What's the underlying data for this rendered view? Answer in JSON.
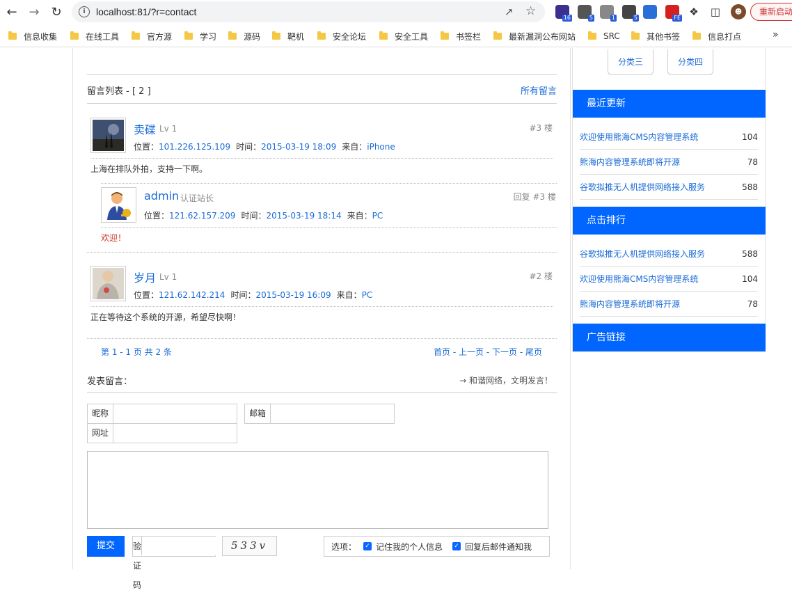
{
  "browser": {
    "url": "localhost:81/?r=contact",
    "restart_label": "重新启动",
    "extensions": [
      {
        "name": "ext-1",
        "badge": "16",
        "color": "#3b2f8f"
      },
      {
        "name": "ext-2",
        "badge": "5",
        "color": "#555555"
      },
      {
        "name": "ext-3",
        "badge": "1",
        "color": "#888888"
      },
      {
        "name": "ext-4",
        "badge": "5",
        "color": "#444444"
      },
      {
        "name": "ext-5",
        "badge": "",
        "color": "#2a6fd6"
      },
      {
        "name": "ext-6",
        "badge": "FE",
        "color": "#d62020"
      }
    ]
  },
  "bookmarks": [
    "信息收集",
    "在线工具",
    "官方源",
    "学习",
    "源码",
    "靶机",
    "安全论坛",
    "安全工具",
    "书签栏",
    "最新漏洞公布网站",
    "SRC",
    "其他书签",
    "信息打点"
  ],
  "comments": {
    "title": "留言列表 - [ 2 ]",
    "all_link": "所有留言",
    "meta_labels": {
      "location": "位置：",
      "time": "时间：",
      "from": "来自："
    },
    "items": [
      {
        "name": "卖碟",
        "level": "Lv 1",
        "floor": "#3 楼",
        "ip": "101.226.125.109",
        "time": "2015-03-19 18:09",
        "from": "iPhone",
        "text": "上海在排队外拍，支持一下啊。",
        "reply": {
          "name": "admin",
          "level": "认证站长",
          "floor": "回复 #3 楼",
          "ip": "121.62.157.209",
          "time": "2015-03-19 18:14",
          "from": "PC",
          "text": "欢迎！"
        }
      },
      {
        "name": "岁月",
        "level": "Lv 1",
        "floor": "#2 楼",
        "ip": "121.62.142.214",
        "time": "2015-03-19 16:09",
        "from": "PC",
        "text": "正在等待这个系统的开源，希望尽快啊！"
      }
    ],
    "pager_info": "第 1 - 1 页 共 2 条",
    "pager": {
      "first": "首页",
      "prev": "上一页",
      "next": "下一页",
      "last": "尾页",
      "sep": " - "
    }
  },
  "form": {
    "title": "发表留言：",
    "hint": "→ 和谐网络，文明发言！",
    "nickname_label": "昵称",
    "email_label": "邮箱",
    "website_label": "网址",
    "submit_label": "提交",
    "captcha_label": "验证码",
    "captcha_text": "533v",
    "options_label": "选项：",
    "remember_label": "记住我的个人信息",
    "notify_label": "回复后邮件通知我"
  },
  "sidebar": {
    "categories": [
      "分类三",
      "分类四"
    ],
    "recent": {
      "title": "最近更新",
      "items": [
        {
          "title": "欢迎使用熊海CMS内容管理系统",
          "count": "104"
        },
        {
          "title": "熊海内容管理系统即将开源",
          "count": "78"
        },
        {
          "title": "谷歌拟推无人机提供网络接入服务",
          "count": "588"
        }
      ]
    },
    "ranking": {
      "title": "点击排行",
      "items": [
        {
          "title": "谷歌拟推无人机提供网络接入服务",
          "count": "588"
        },
        {
          "title": "欢迎使用熊海CMS内容管理系统",
          "count": "104"
        },
        {
          "title": "熊海内容管理系统即将开源",
          "count": "78"
        }
      ]
    },
    "ads_title": "广告链接"
  }
}
